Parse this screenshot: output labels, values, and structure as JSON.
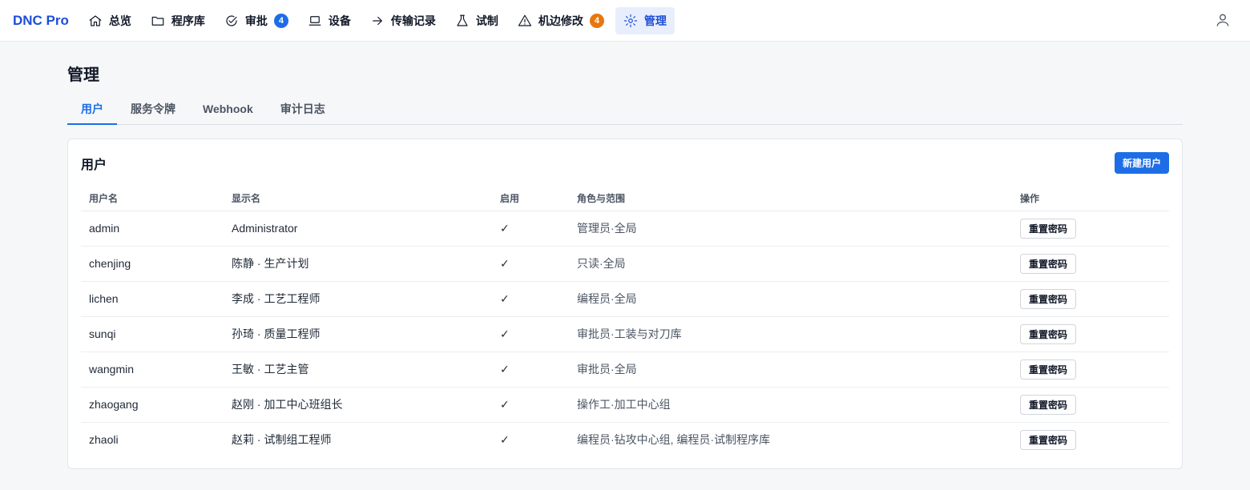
{
  "app": {
    "brand": "DNC Pro"
  },
  "nav": {
    "items": [
      {
        "label": "总览"
      },
      {
        "label": "程序库"
      },
      {
        "label": "审批",
        "badge": "4"
      },
      {
        "label": "设备"
      },
      {
        "label": "传输记录"
      },
      {
        "label": "试制"
      },
      {
        "label": "机边修改",
        "badge": "4"
      },
      {
        "label": "管理"
      }
    ]
  },
  "page": {
    "title": "管理",
    "tabs": [
      {
        "label": "用户"
      },
      {
        "label": "服务令牌"
      },
      {
        "label": "Webhook"
      },
      {
        "label": "审计日志"
      }
    ]
  },
  "card": {
    "title": "用户",
    "new_button": "新建用户",
    "columns": {
      "username": "用户名",
      "display": "显示名",
      "enabled": "启用",
      "roles": "角色与范围",
      "actions": "操作"
    },
    "rows": [
      {
        "username": "admin",
        "display": "Administrator",
        "enabled": "✓",
        "roles": "管理员·全局",
        "action": "重置密码"
      },
      {
        "username": "chenjing",
        "display": "陈静 · 生产计划",
        "enabled": "✓",
        "roles": "只读·全局",
        "action": "重置密码"
      },
      {
        "username": "lichen",
        "display": "李成 · 工艺工程师",
        "enabled": "✓",
        "roles": "编程员·全局",
        "action": "重置密码"
      },
      {
        "username": "sunqi",
        "display": "孙琦 · 质量工程师",
        "enabled": "✓",
        "roles": "审批员·工装与对刀库",
        "action": "重置密码"
      },
      {
        "username": "wangmin",
        "display": "王敏 · 工艺主管",
        "enabled": "✓",
        "roles": "审批员·全局",
        "action": "重置密码"
      },
      {
        "username": "zhaogang",
        "display": "赵刚 · 加工中心班组长",
        "enabled": "✓",
        "roles": "操作工·加工中心组",
        "action": "重置密码"
      },
      {
        "username": "zhaoli",
        "display": "赵莉 · 试制组工程师",
        "enabled": "✓",
        "roles": "编程员·钻攻中心组, 编程员·试制程序库",
        "action": "重置密码"
      }
    ]
  },
  "colors": {
    "brand": "#1d4ed8",
    "accent": "#1d6ee6",
    "badge_orange": "#e8770f",
    "active_nav_bg": "#e8eefb"
  }
}
